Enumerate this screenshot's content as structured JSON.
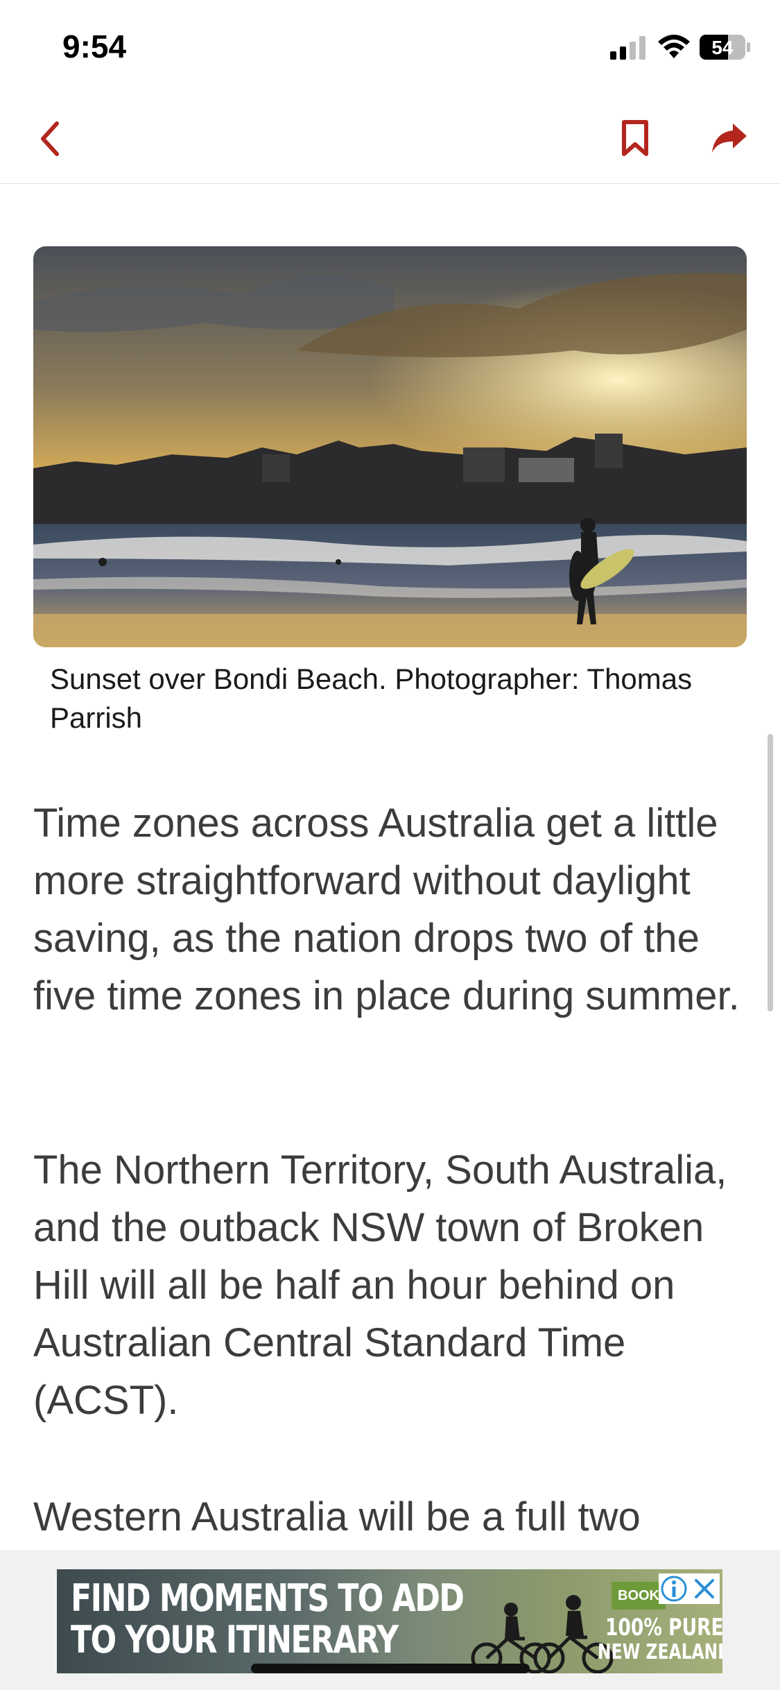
{
  "status_bar": {
    "time": "9:54",
    "battery_level": "54"
  },
  "nav": {
    "back_icon": "chevron-left-icon",
    "bookmark_icon": "bookmark-icon",
    "share_icon": "share-arrow-icon",
    "accent_color": "#b3261e"
  },
  "article": {
    "image_caption": "Sunset over Bondi Beach. Photographer: Thomas Parrish",
    "paragraphs": [
      "Time zones across Australia get a little more straightforward without daylight saving, as the nation drops two of the five time zones in place during summer.",
      "The Northern Territory, South Australia, and the outback NSW town of Broken Hill will all be half an hour behind on Australian Central Standard Time (ACST).",
      "Western Australia will be a full two"
    ]
  },
  "ad": {
    "headline_line1": "FIND MOMENTS TO ADD",
    "headline_line2": "TO YOUR ITINERARY",
    "book_label": "BOOK",
    "tagline_line1": "100% PURE",
    "tagline_line2": "NEW ZEALAND",
    "info_icon": "info-icon",
    "close_icon": "close-icon"
  }
}
